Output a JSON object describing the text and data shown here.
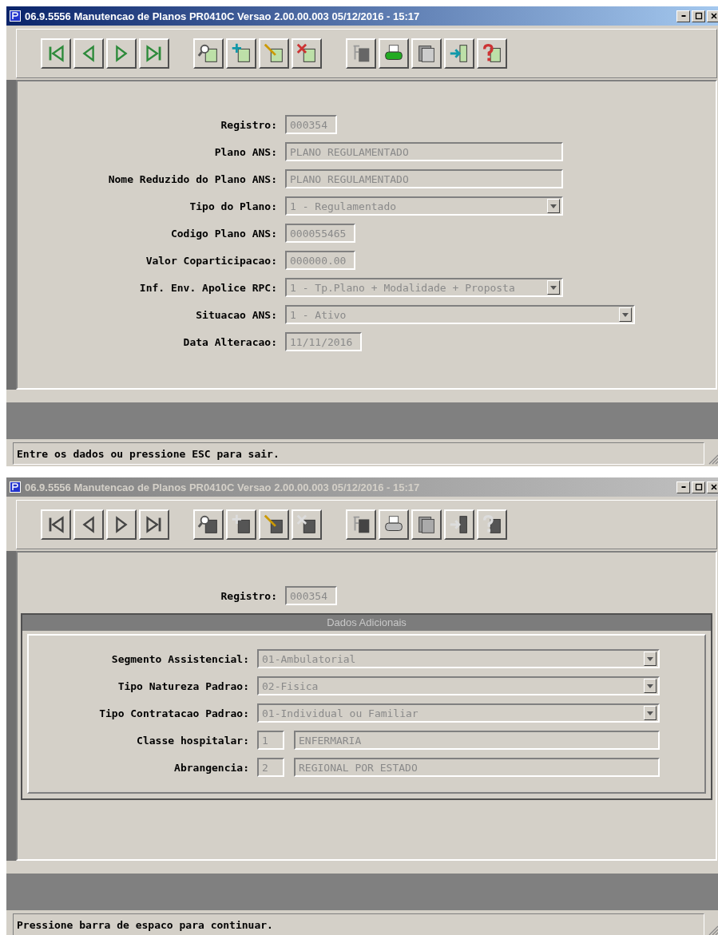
{
  "windows": [
    {
      "title": "06.9.5556  Manutencao de Planos PR0410C Versao 2.00.00.003 05/12/2016 - 15:17",
      "active": true,
      "toolbar": [
        {
          "kind": "first",
          "disabled": false
        },
        {
          "kind": "prev",
          "disabled": false
        },
        {
          "kind": "next",
          "disabled": false
        },
        {
          "kind": "last",
          "disabled": false
        },
        {
          "kind": "search",
          "disabled": false
        },
        {
          "kind": "add",
          "disabled": false
        },
        {
          "kind": "edit",
          "disabled": false
        },
        {
          "kind": "delete",
          "disabled": false
        },
        {
          "kind": "filter",
          "disabled": false
        },
        {
          "kind": "print",
          "disabled": false
        },
        {
          "kind": "copy",
          "disabled": false
        },
        {
          "kind": "exit",
          "disabled": false
        },
        {
          "kind": "help",
          "disabled": false
        }
      ],
      "fields": [
        {
          "label": "Registro:",
          "kind": "short",
          "value": "000354"
        },
        {
          "label": "Plano ANS:",
          "kind": "text",
          "value": "PLANO REGULAMENTADO"
        },
        {
          "label": "Nome Reduzido do Plano ANS:",
          "kind": "text",
          "value": "PLANO REGULAMENTADO"
        },
        {
          "label": "Tipo do Plano:",
          "kind": "select",
          "value": "1 - Regulamentado"
        },
        {
          "label": "Codigo Plano ANS:",
          "kind": "short",
          "value": "000055465"
        },
        {
          "label": "Valor Coparticipacao:",
          "kind": "short",
          "value": "000000.00"
        },
        {
          "label": "Inf. Env. Apolice RPC:",
          "kind": "select",
          "value": "1 - Tp.Plano + Modalidade + Proposta"
        },
        {
          "label": "Situacao ANS:",
          "kind": "select",
          "value": "1 - Ativo",
          "wide": true
        },
        {
          "label": "Data Alteracao:",
          "kind": "short",
          "value": "11/11/2016"
        }
      ],
      "status": "Entre os dados ou pressione ESC para sair."
    },
    {
      "title": "06.9.5556  Manutencao de Planos PR0410C Versao 2.00.00.003 05/12/2016 - 15:17",
      "active": false,
      "toolbar": [
        {
          "kind": "first",
          "disabled": true
        },
        {
          "kind": "prev",
          "disabled": true
        },
        {
          "kind": "next",
          "disabled": true
        },
        {
          "kind": "last",
          "disabled": true
        },
        {
          "kind": "search",
          "disabled": true
        },
        {
          "kind": "add",
          "disabled": true
        },
        {
          "kind": "edit",
          "disabled": true
        },
        {
          "kind": "delete",
          "disabled": true
        },
        {
          "kind": "filter",
          "disabled": true
        },
        {
          "kind": "print",
          "disabled": true
        },
        {
          "kind": "copy",
          "disabled": true
        },
        {
          "kind": "exit",
          "disabled": true
        },
        {
          "kind": "help",
          "disabled": true
        }
      ],
      "fields": [
        {
          "label": "Registro:",
          "kind": "short",
          "value": "000354"
        }
      ],
      "dialog": {
        "title": "Dados Adicionais",
        "fields": [
          {
            "label": "Segmento Assistencial:",
            "kind": "select",
            "value": "01-Ambulatorial"
          },
          {
            "label": "Tipo Natureza Padrao:",
            "kind": "select",
            "value": "02-Fisica"
          },
          {
            "label": "Tipo Contratacao Padrao:",
            "kind": "select",
            "value": "01-Individual ou Familiar"
          },
          {
            "label": "Classe hospitalar:",
            "kind": "code",
            "code": "1",
            "value": "ENFERMARIA"
          },
          {
            "label": "Abrangencia:",
            "kind": "code",
            "code": "2",
            "value": "REGIONAL POR ESTADO"
          }
        ]
      },
      "status": "Pressione barra de espaco para continuar."
    }
  ]
}
